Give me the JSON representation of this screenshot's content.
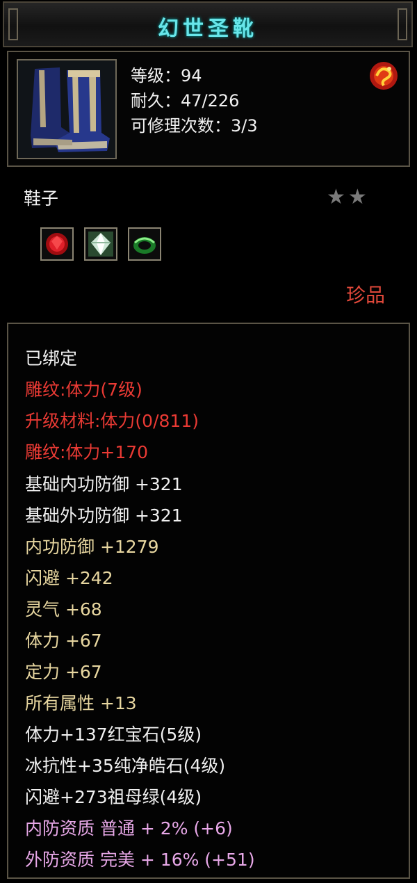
{
  "item": {
    "name": "幻世圣靴",
    "stats": {
      "level": "等级：94",
      "durability": "耐久：47/226",
      "repairs": "可修理次数：3/3"
    },
    "type": "鞋子",
    "stars": "★★",
    "rarity": "珍品"
  },
  "attributes": [
    {
      "text": "已绑定",
      "color": "#f0f0f0"
    },
    {
      "text": "雕纹:体力(7级)",
      "color": "#ea3a34"
    },
    {
      "text": "升级材料:体力(0/811)",
      "color": "#ea3a34"
    },
    {
      "text": "雕纹:体力+170",
      "color": "#ea3a34"
    },
    {
      "text": "基础内功防御 +321",
      "color": "#f0f0f0"
    },
    {
      "text": "基础外功防御 +321",
      "color": "#f0f0f0"
    },
    {
      "text": "内功防御 +1279",
      "color": "#e8d7a0"
    },
    {
      "text": "闪避 +242",
      "color": "#e8d7a0"
    },
    {
      "text": "灵气 +68",
      "color": "#e8d7a0"
    },
    {
      "text": "体力 +67",
      "color": "#e8d7a0"
    },
    {
      "text": "定力 +67",
      "color": "#e8d7a0"
    },
    {
      "text": "所有属性 +13",
      "color": "#e8d7a0"
    },
    {
      "text": "体力+137红宝石(5级)",
      "color": "#f0f0f0"
    },
    {
      "text": "冰抗性+35纯净皓石(4级)",
      "color": "#f0f0f0"
    },
    {
      "text": "闪避+273祖母绿(4级)",
      "color": "#f0f0f0"
    },
    {
      "text": "内防资质 普通 + 2% (+6)",
      "color": "#e8a8e8"
    },
    {
      "text": "外防资质 完美 + 16% (+51)",
      "color": "#e8a8e8"
    }
  ],
  "icons": [
    "boots-icon",
    "fire-orb-icon",
    "ruby-gem-icon",
    "diamond-gem-icon",
    "emerald-gem-icon"
  ]
}
